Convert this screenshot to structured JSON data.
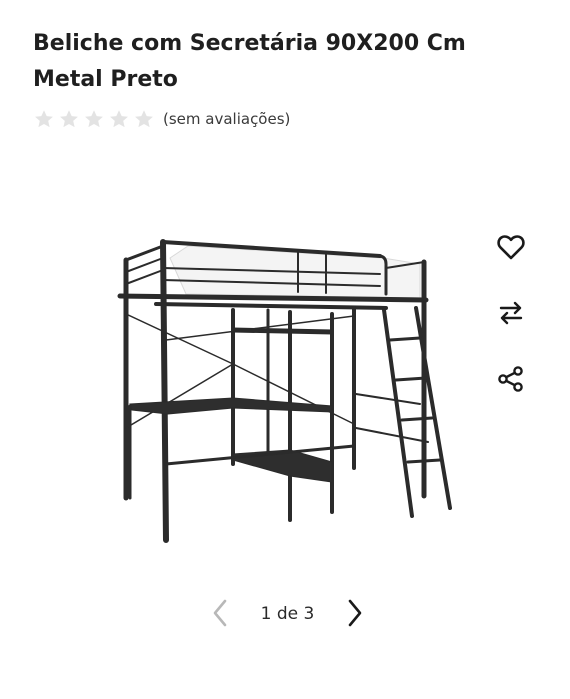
{
  "product": {
    "title_line1": "Beliche com Secretária 90X200 Cm",
    "title_line2": "Metal Preto",
    "rating_text": "(sem avaliações)",
    "rating_value": 0,
    "rating_max": 5,
    "image_alt_icon": "loft-bed-with-desk-photo"
  },
  "actions": {
    "wishlist_icon": "heart-icon",
    "compare_icon": "compare-arrows-icon",
    "share_icon": "share-icon"
  },
  "gallery": {
    "current": 1,
    "total": 3,
    "counter_text": "1 de 3"
  },
  "colors": {
    "star_empty": "#e3e3e3",
    "icon": "#1a1a1a",
    "arrow_disabled": "#b8b8b8",
    "arrow_active": "#1a1a1a"
  }
}
